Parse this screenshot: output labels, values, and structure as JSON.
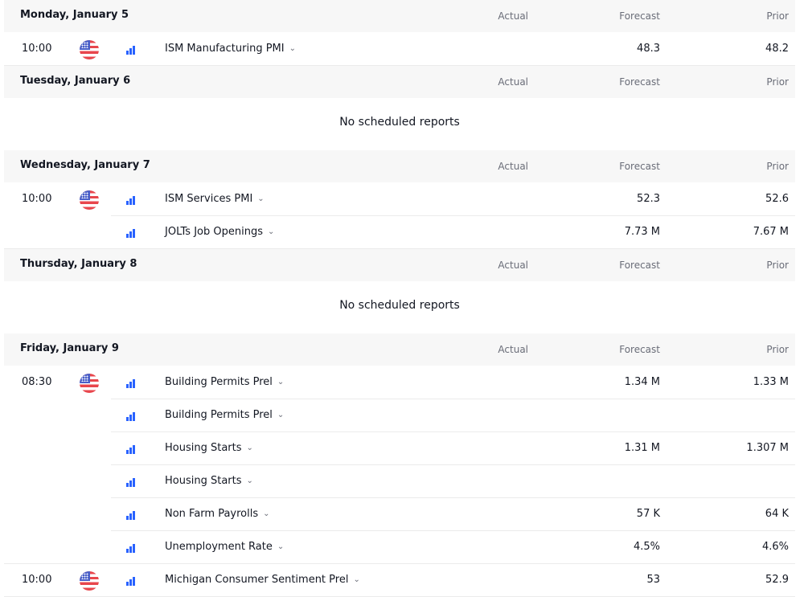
{
  "columns": {
    "actual": "Actual",
    "forecast": "Forecast",
    "prior": "Prior"
  },
  "empty_text": "No scheduled reports",
  "days": [
    {
      "title": "Monday, January 5",
      "events": [
        {
          "time": "10:00",
          "flag": "us-flag-icon",
          "name": "ISM Manufacturing PMI",
          "actual": "",
          "forecast": "48.3",
          "prior": "48.2"
        }
      ]
    },
    {
      "title": "Tuesday, January 6",
      "events": []
    },
    {
      "title": "Wednesday, January 7",
      "events": [
        {
          "time": "10:00",
          "flag": "us-flag-icon",
          "name": "ISM Services PMI",
          "actual": "",
          "forecast": "52.3",
          "prior": "52.6"
        },
        {
          "time": "",
          "flag": "",
          "name": "JOLTs Job Openings",
          "actual": "",
          "forecast": "7.73 M",
          "prior": "7.67 M"
        }
      ]
    },
    {
      "title": "Thursday, January 8",
      "events": []
    },
    {
      "title": "Friday, January 9",
      "events": [
        {
          "time": "08:30",
          "flag": "us-flag-icon",
          "name": "Building Permits Prel",
          "actual": "",
          "forecast": "1.34 M",
          "prior": "1.33 M"
        },
        {
          "time": "",
          "flag": "",
          "name": "Building Permits Prel",
          "actual": "",
          "forecast": "",
          "prior": ""
        },
        {
          "time": "",
          "flag": "",
          "name": "Housing Starts",
          "actual": "",
          "forecast": "1.31 M",
          "prior": "1.307 M"
        },
        {
          "time": "",
          "flag": "",
          "name": "Housing Starts",
          "actual": "",
          "forecast": "",
          "prior": ""
        },
        {
          "time": "",
          "flag": "",
          "name": "Non Farm Payrolls",
          "actual": "",
          "forecast": "57 K",
          "prior": "64 K"
        },
        {
          "time": "",
          "flag": "",
          "name": "Unemployment Rate",
          "actual": "",
          "forecast": "4.5%",
          "prior": "4.6%"
        },
        {
          "time": "10:00",
          "flag": "us-flag-icon",
          "name": "Michigan Consumer Sentiment Prel",
          "actual": "",
          "forecast": "53",
          "prior": "52.9"
        }
      ]
    }
  ],
  "colors": {
    "header_bg": "#f7f7f7",
    "importance_bar": "#2962ff",
    "muted_text": "#6a6d78"
  }
}
